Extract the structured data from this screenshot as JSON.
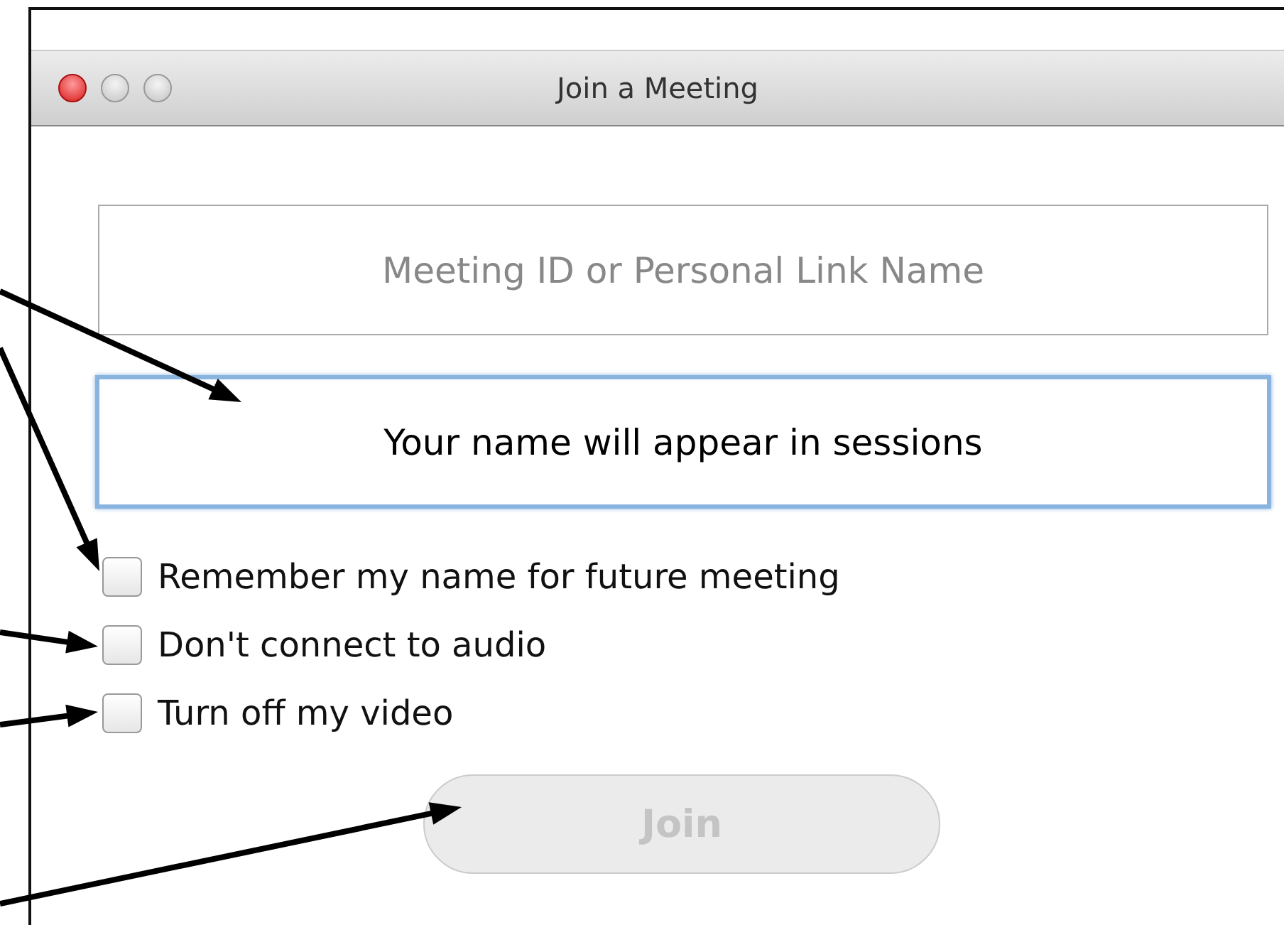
{
  "window": {
    "title": "Join a Meeting"
  },
  "fields": [
    {
      "kind": "placeholder",
      "placeholder": "Meeting ID or Personal Link Name",
      "focused": false
    },
    {
      "kind": "value",
      "value": "Your name will appear in sessions",
      "focused": true
    }
  ],
  "options": [
    {
      "label": "Remember my name for future meeting",
      "checked": false
    },
    {
      "label": "Don't connect to audio",
      "checked": false
    },
    {
      "label": "Turn off my video",
      "checked": false
    }
  ],
  "join_button": {
    "label": "Join",
    "disabled": true
  }
}
